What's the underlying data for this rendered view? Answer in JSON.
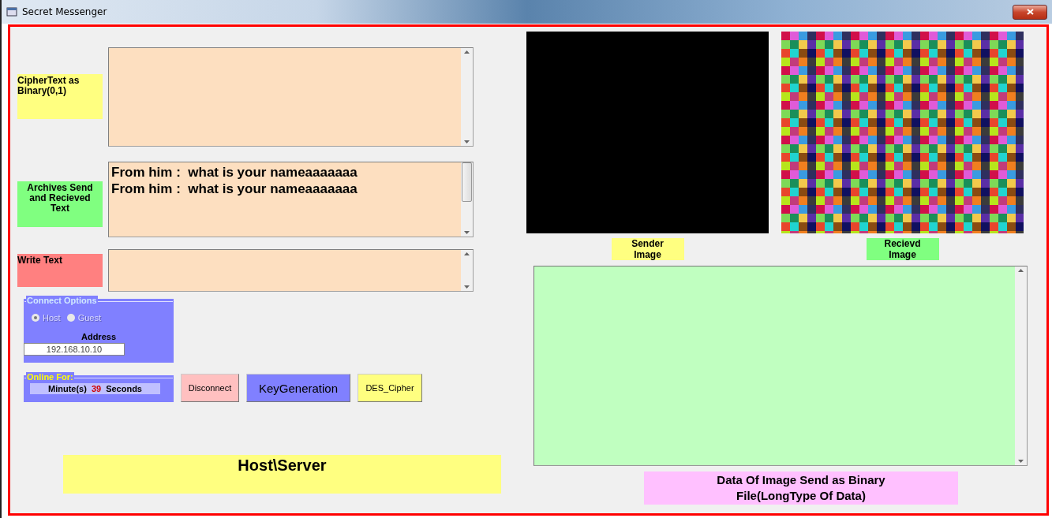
{
  "window": {
    "title": "Secret Messenger"
  },
  "text_panels": [
    {
      "label": "CipherText as Binary(0,1)",
      "color": "#ffff80"
    },
    {
      "label": "Archives Send and Recieved Text",
      "color": "#80ff80",
      "lines": [
        "From him :  what is your nameaaaaaaa",
        "From him :  what is your nameaaaaaaa"
      ]
    },
    {
      "label": "Write Text",
      "color": "#ff8080"
    }
  ],
  "connect_options": {
    "title": "Connect Options",
    "options": [
      {
        "label": "Host",
        "selected": true
      },
      {
        "label": "Guest",
        "selected": false
      }
    ],
    "address_label": "Address",
    "address": "192.168.10.10"
  },
  "online_for": {
    "title": "Online For:",
    "minutes_label": "Minute(s)",
    "seconds": "39",
    "seconds_label": "Seconds"
  },
  "buttons": [
    {
      "label": "Disconnect",
      "color": "#ffc0c0"
    },
    {
      "label": "KeyGeneration",
      "color": "#8080ff"
    },
    {
      "label": "DES_Cipher",
      "color": "#ffff80"
    }
  ],
  "role_banner": "Host\\Server",
  "images": [
    {
      "caption": "Sender Image",
      "color": "#ffff80",
      "kind": "blank"
    },
    {
      "caption": "Recievd Image",
      "color": "#80ff80",
      "kind": "picture"
    }
  ],
  "binary_data": {
    "caption": "Data Of Image Send as Binary File(LongType Of Data)"
  }
}
